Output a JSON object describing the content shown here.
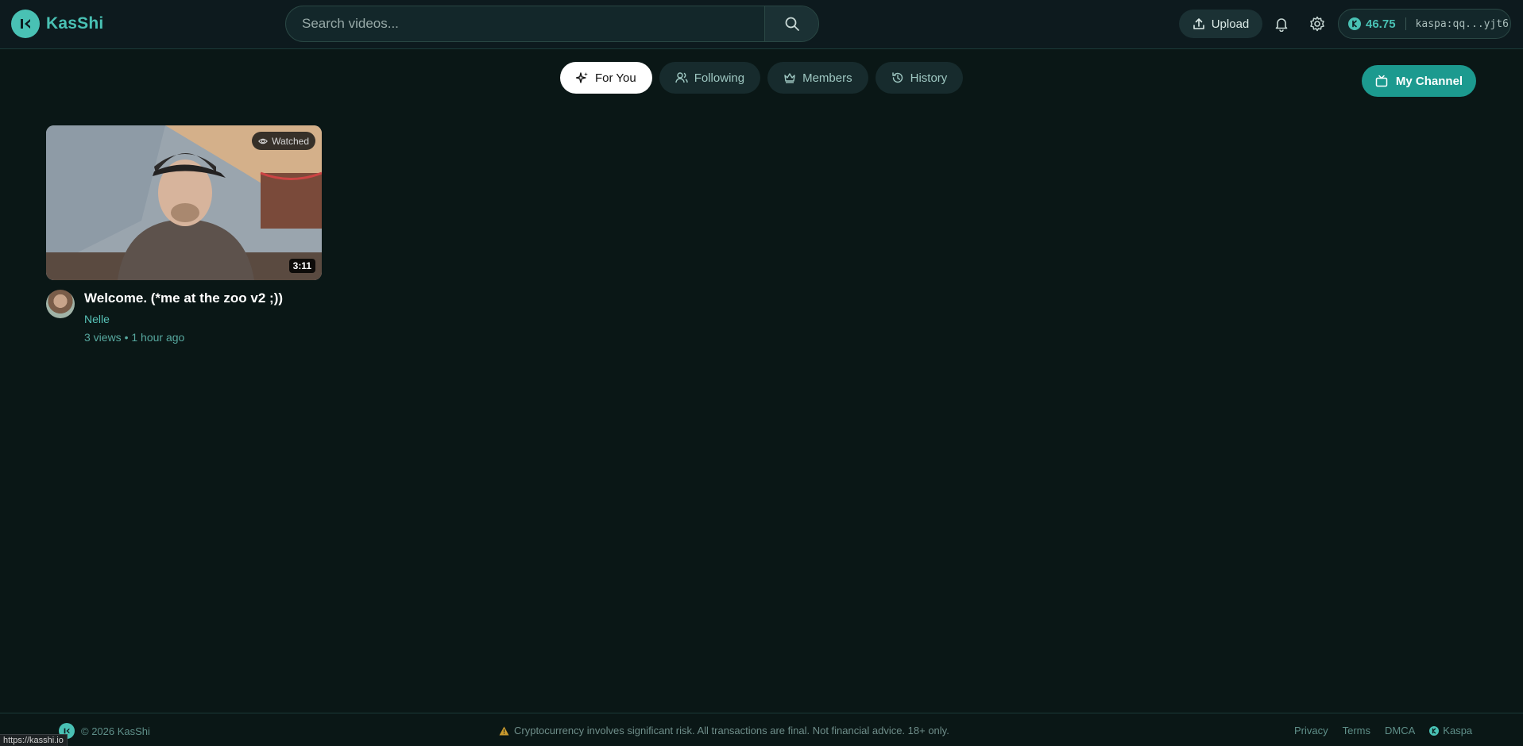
{
  "header": {
    "logo_text": "KasShi",
    "search_placeholder": "Search videos...",
    "upload_label": "Upload",
    "wallet_balance": "46.75",
    "wallet_address": "kaspa:qq...yjt6"
  },
  "tabs": [
    {
      "label": "For You",
      "icon": "sparkles-icon",
      "active": true
    },
    {
      "label": "Following",
      "icon": "users-icon",
      "active": false
    },
    {
      "label": "Members",
      "icon": "crown-icon",
      "active": false
    },
    {
      "label": "History",
      "icon": "history-icon",
      "active": false
    }
  ],
  "my_channel_label": "My Channel",
  "videos": [
    {
      "title": "Welcome. (*me at the zoo v2 ;))",
      "channel": "Nelle",
      "stats": "3 views • 1 hour ago",
      "duration": "3:11",
      "badge": "Watched"
    }
  ],
  "footer": {
    "copyright": "© 2026 KasShi",
    "disclaimer": "Cryptocurrency involves significant risk. All transactions are final. Not financial advice. 18+ only.",
    "links": [
      "Privacy",
      "Terms",
      "DMCA",
      "Kaspa"
    ]
  },
  "status_bar_url": "https://kasshi.io",
  "colors": {
    "accent": "#49c1b4",
    "channel_button": "#1c9a8f",
    "background": "#0a1716"
  }
}
